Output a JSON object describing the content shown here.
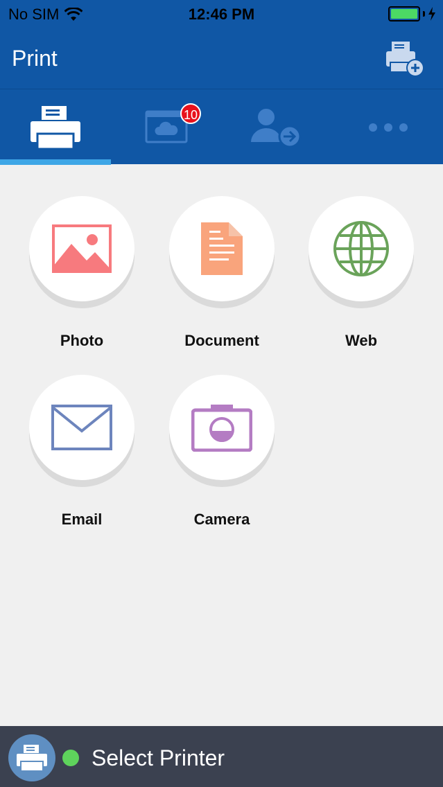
{
  "status_bar": {
    "carrier": "No SIM",
    "time": "12:46 PM",
    "battery_color": "#4cd964"
  },
  "header": {
    "title": "Print",
    "add_printer_icon": "add-printer-icon"
  },
  "tabs": [
    {
      "name": "print",
      "icon": "printer-icon",
      "active": true
    },
    {
      "name": "cloud-photos",
      "icon": "cloud-photo-icon",
      "badge": "10"
    },
    {
      "name": "account",
      "icon": "user-arrow-icon"
    },
    {
      "name": "more",
      "icon": "more-icon"
    }
  ],
  "grid": {
    "items": [
      {
        "label": "Photo",
        "icon": "photo-icon",
        "color": "#f77a7e"
      },
      {
        "label": "Document",
        "icon": "document-icon",
        "color": "#f9a47c"
      },
      {
        "label": "Web",
        "icon": "globe-icon",
        "color": "#6aa35a"
      },
      {
        "label": "Email",
        "icon": "envelope-icon",
        "color": "#6d85bd"
      },
      {
        "label": "Camera",
        "icon": "camera-icon",
        "color": "#b47cc3"
      }
    ]
  },
  "bottom_bar": {
    "label": "Select Printer",
    "status_color": "#5ed35c"
  },
  "colors": {
    "brand": "#1057a5",
    "tab_indicator": "#3ea6e6",
    "badge": "#e8111b",
    "background": "#f0f0f0",
    "bottom_bar": "#3b4150"
  }
}
